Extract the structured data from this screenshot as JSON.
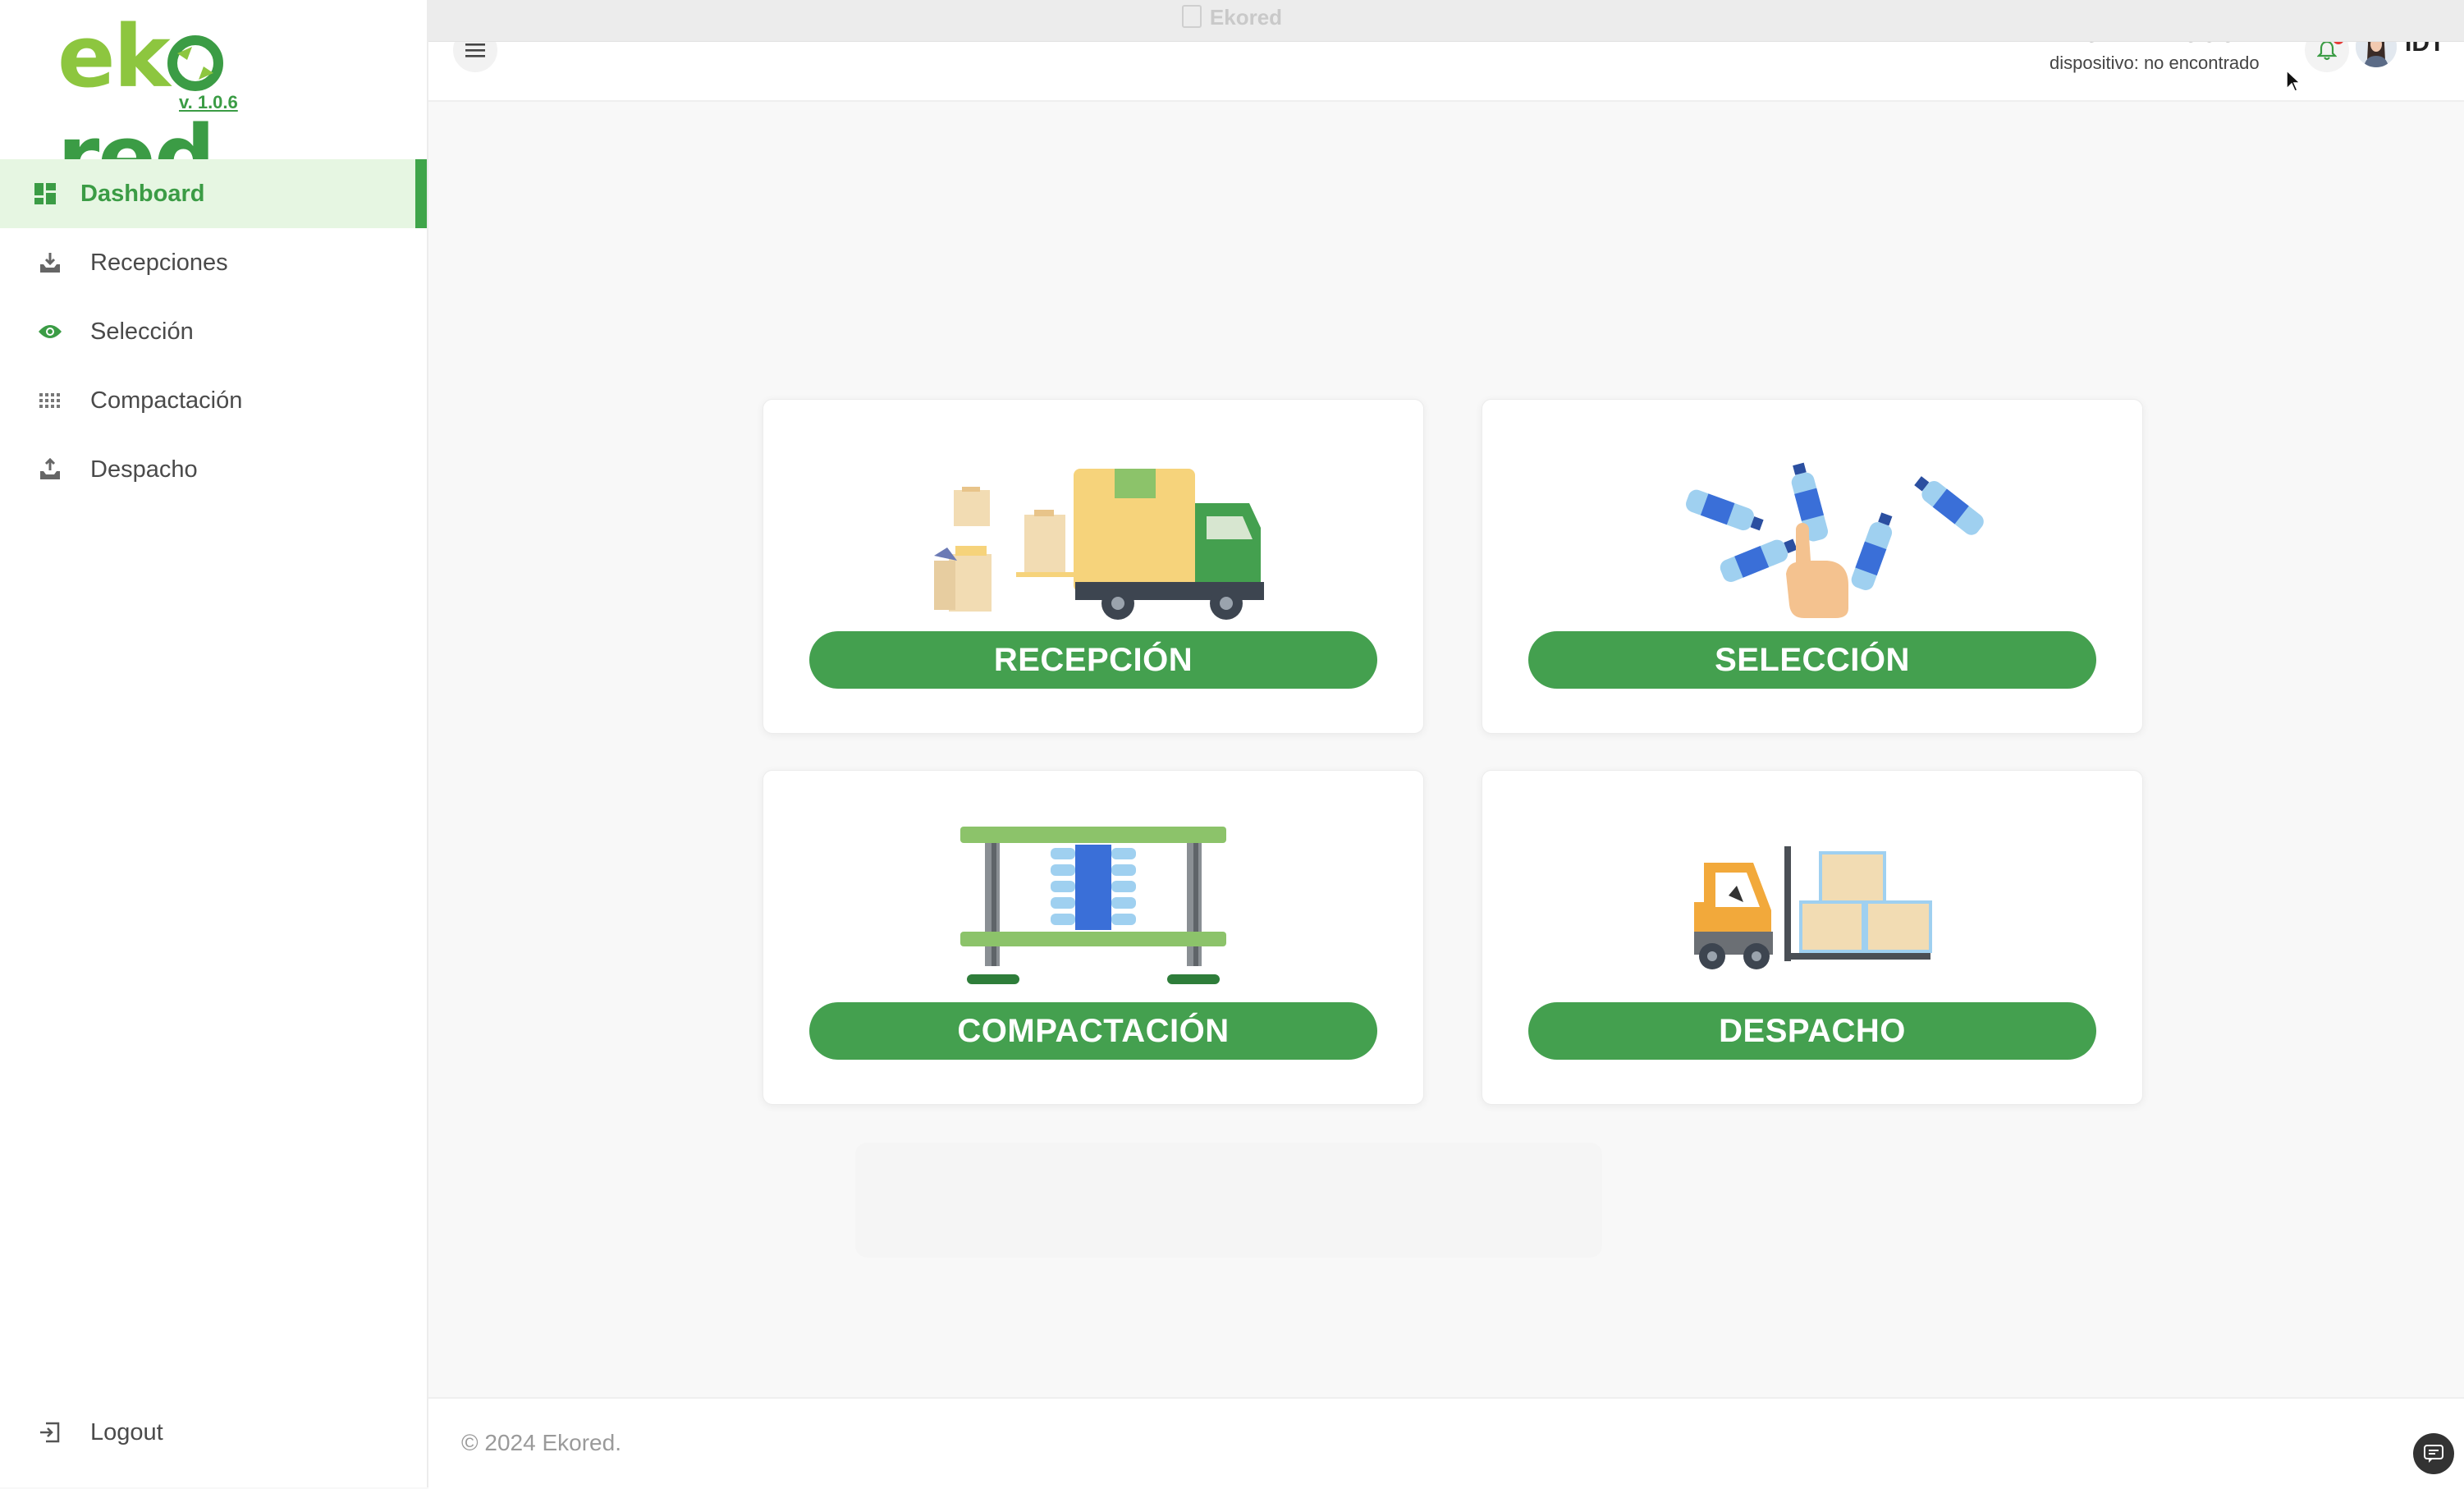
{
  "window": {
    "title": "Ekored"
  },
  "brand": {
    "logo_text_a": "ek",
    "logo_text_b": "red",
    "version": "v. 1.0.6"
  },
  "sidebar": {
    "items": [
      {
        "label": "Dashboard",
        "icon": "dashboard-icon",
        "active": true
      },
      {
        "label": "Recepciones",
        "icon": "inbox-download-icon"
      },
      {
        "label": "Selección",
        "icon": "eye-icon"
      },
      {
        "label": "Compactación",
        "icon": "grid-dots-icon"
      },
      {
        "label": "Despacho",
        "icon": "inbox-upload-icon"
      }
    ],
    "logout": "Logout"
  },
  "header": {
    "org_name": "EKO RED BOGOTA",
    "device_status": "dispositivo: no encontrado",
    "user": "IDT",
    "notifications_badge": true
  },
  "cards": [
    {
      "label": "RECEPCIÓN",
      "illustration": "delivery-truck-illustration"
    },
    {
      "label": "SELECCIÓN",
      "illustration": "bottle-sorting-illustration"
    },
    {
      "label": "COMPACTACIÓN",
      "illustration": "compactor-press-illustration"
    },
    {
      "label": "DESPACHO",
      "illustration": "forklift-boxes-illustration"
    }
  ],
  "footer": {
    "copyright": "© 2024 Ekored."
  },
  "colors": {
    "primary": "#44a04f",
    "active_bg": "#e6f6e2",
    "logo_light": "#8dc63f",
    "logo_dark": "#3b9c45"
  }
}
